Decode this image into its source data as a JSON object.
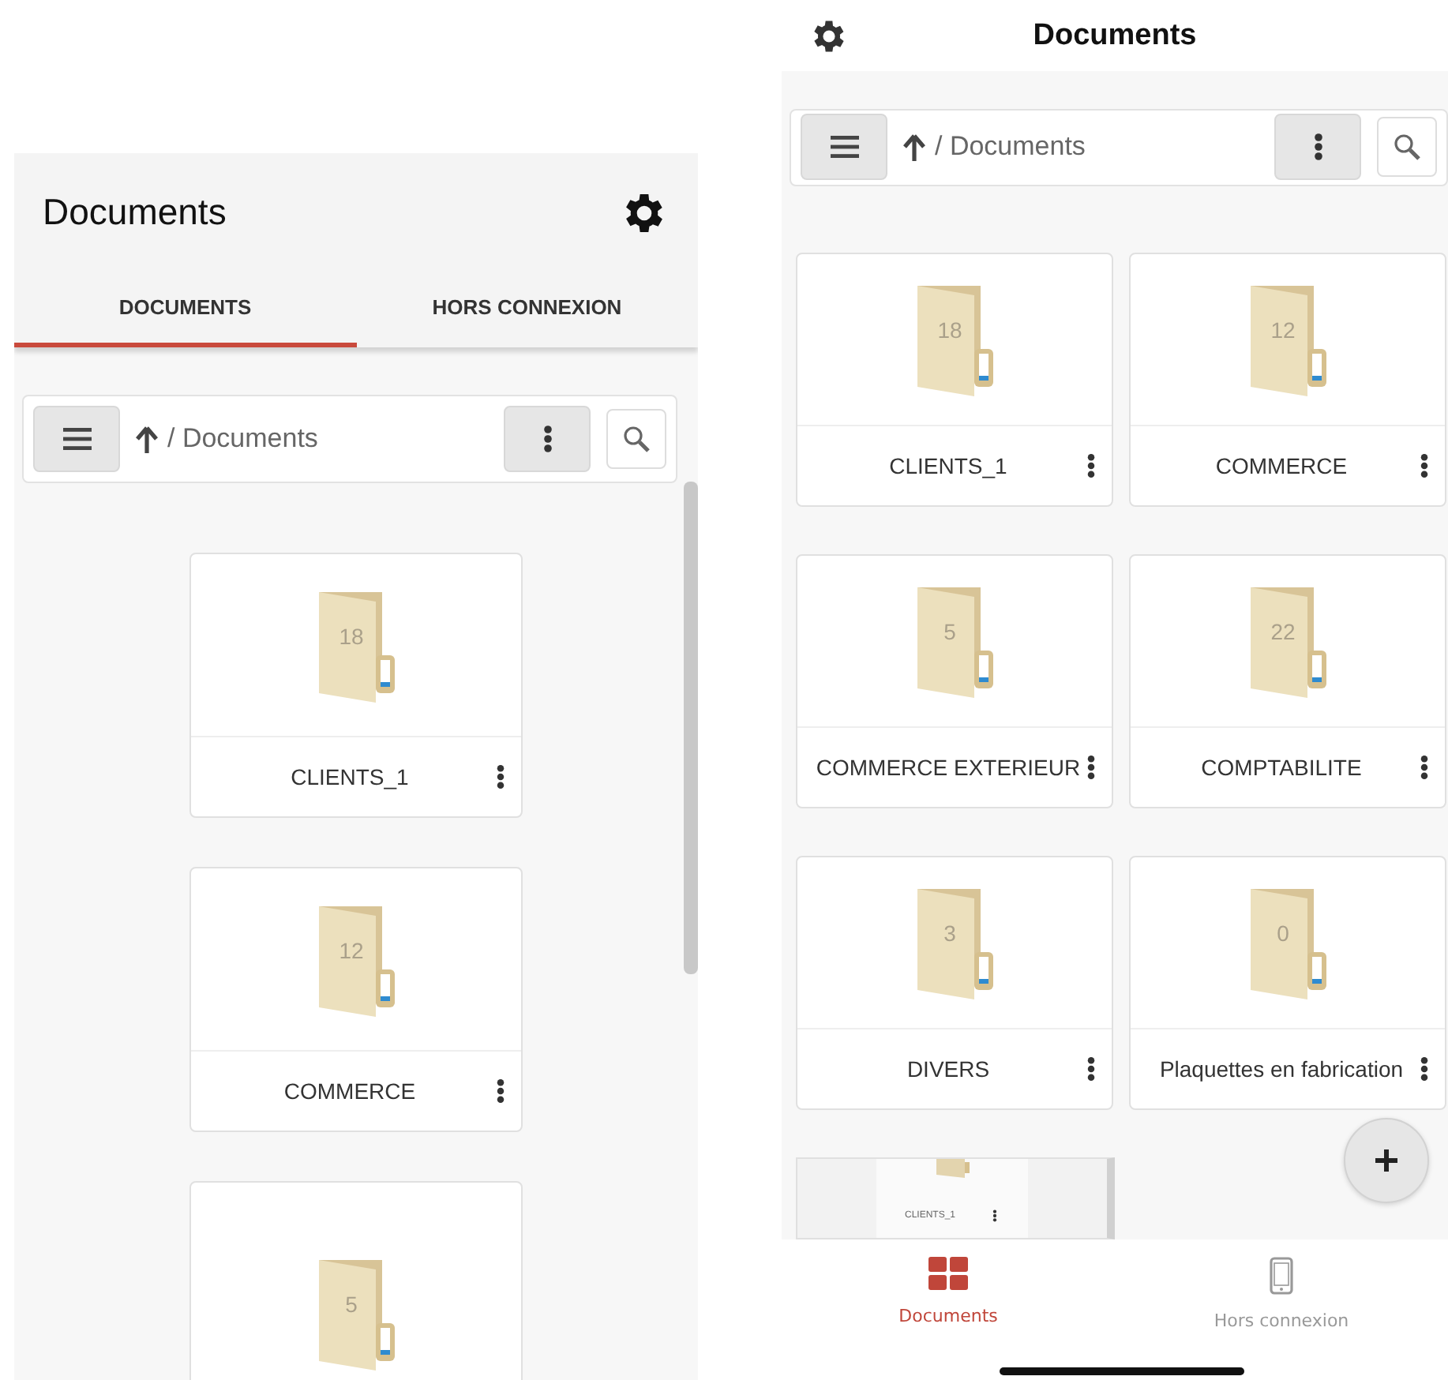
{
  "left_screen": {
    "title": "Documents",
    "tabs": [
      {
        "label": "DOCUMENTS",
        "selected": true
      },
      {
        "label": "HORS CONNEXION",
        "selected": false
      }
    ],
    "toolbar": {
      "path": "/ Documents"
    },
    "folders": [
      {
        "count": "18",
        "name": "CLIENTS_1"
      },
      {
        "count": "12",
        "name": "COMMERCE"
      },
      {
        "count": "5"
      }
    ]
  },
  "right_screen": {
    "title": "Documents",
    "toolbar": {
      "path": "/ Documents"
    },
    "folders": [
      {
        "count": "18",
        "name": "CLIENTS_1"
      },
      {
        "count": "12",
        "name": "COMMERCE"
      },
      {
        "count": "5",
        "name": "COMMERCE EXTERIEUR"
      },
      {
        "count": "22",
        "name": "COMPTABILITE"
      },
      {
        "count": "3",
        "name": "DIVERS"
      },
      {
        "count": "0",
        "name": "Plaquettes en fabrication"
      }
    ],
    "preview_thumbnail": {
      "name": "CLIENTS_1"
    },
    "bottom_tabs": [
      {
        "label": "Documents",
        "kind": "grid",
        "selected": true
      },
      {
        "label": "Hors connexion",
        "kind": "phone",
        "selected": false
      }
    ]
  }
}
